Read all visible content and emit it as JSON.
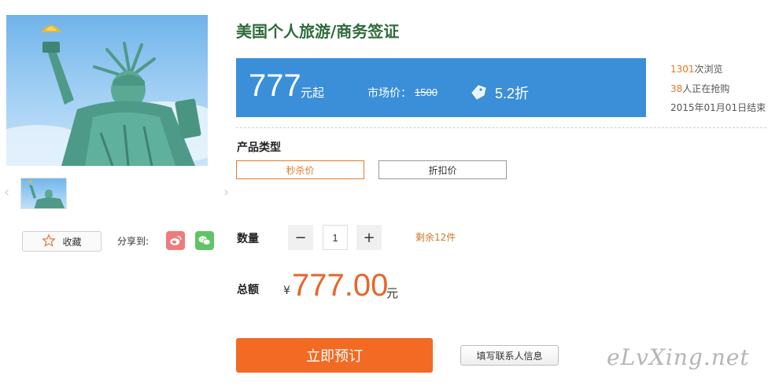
{
  "product": {
    "title": "美国个人旅游/商务签证"
  },
  "price": {
    "value": "777",
    "suffix": "元起",
    "market_label": "市场价：",
    "market_value": "1500",
    "discount": "5.2折"
  },
  "stats": {
    "views_count": "1301",
    "views_label": "次浏览",
    "buyers_count": "38",
    "buyers_label": "人正在抢购",
    "end_text": "2015年01月01日结束"
  },
  "options": {
    "type_label": "产品类型",
    "items": [
      "秒杀价",
      "折扣价"
    ],
    "selected_index": 0
  },
  "quantity": {
    "label": "数量",
    "value": "1",
    "minus": "−",
    "plus": "+",
    "stock_text": "剩余12件"
  },
  "total": {
    "label": "总额",
    "currency": "¥",
    "amount": "777.00",
    "unit": "元"
  },
  "actions": {
    "book_label": "立即预订",
    "contact_label": "填写联系人信息",
    "favorite_label": "收藏",
    "share_label": "分享到:"
  },
  "gallery": {
    "prev": "‹",
    "next": "›"
  },
  "icons": {
    "favorite": "star-icon",
    "weibo": "weibo-icon",
    "wechat": "wechat-icon",
    "discount": "tag-icon"
  },
  "watermark": "eLvXing.net",
  "colors": {
    "accent_orange": "#f26a23",
    "price_box_blue": "#3b8fd9",
    "title_green": "#2e6b3a",
    "highlight_orange": "#e5772b"
  }
}
